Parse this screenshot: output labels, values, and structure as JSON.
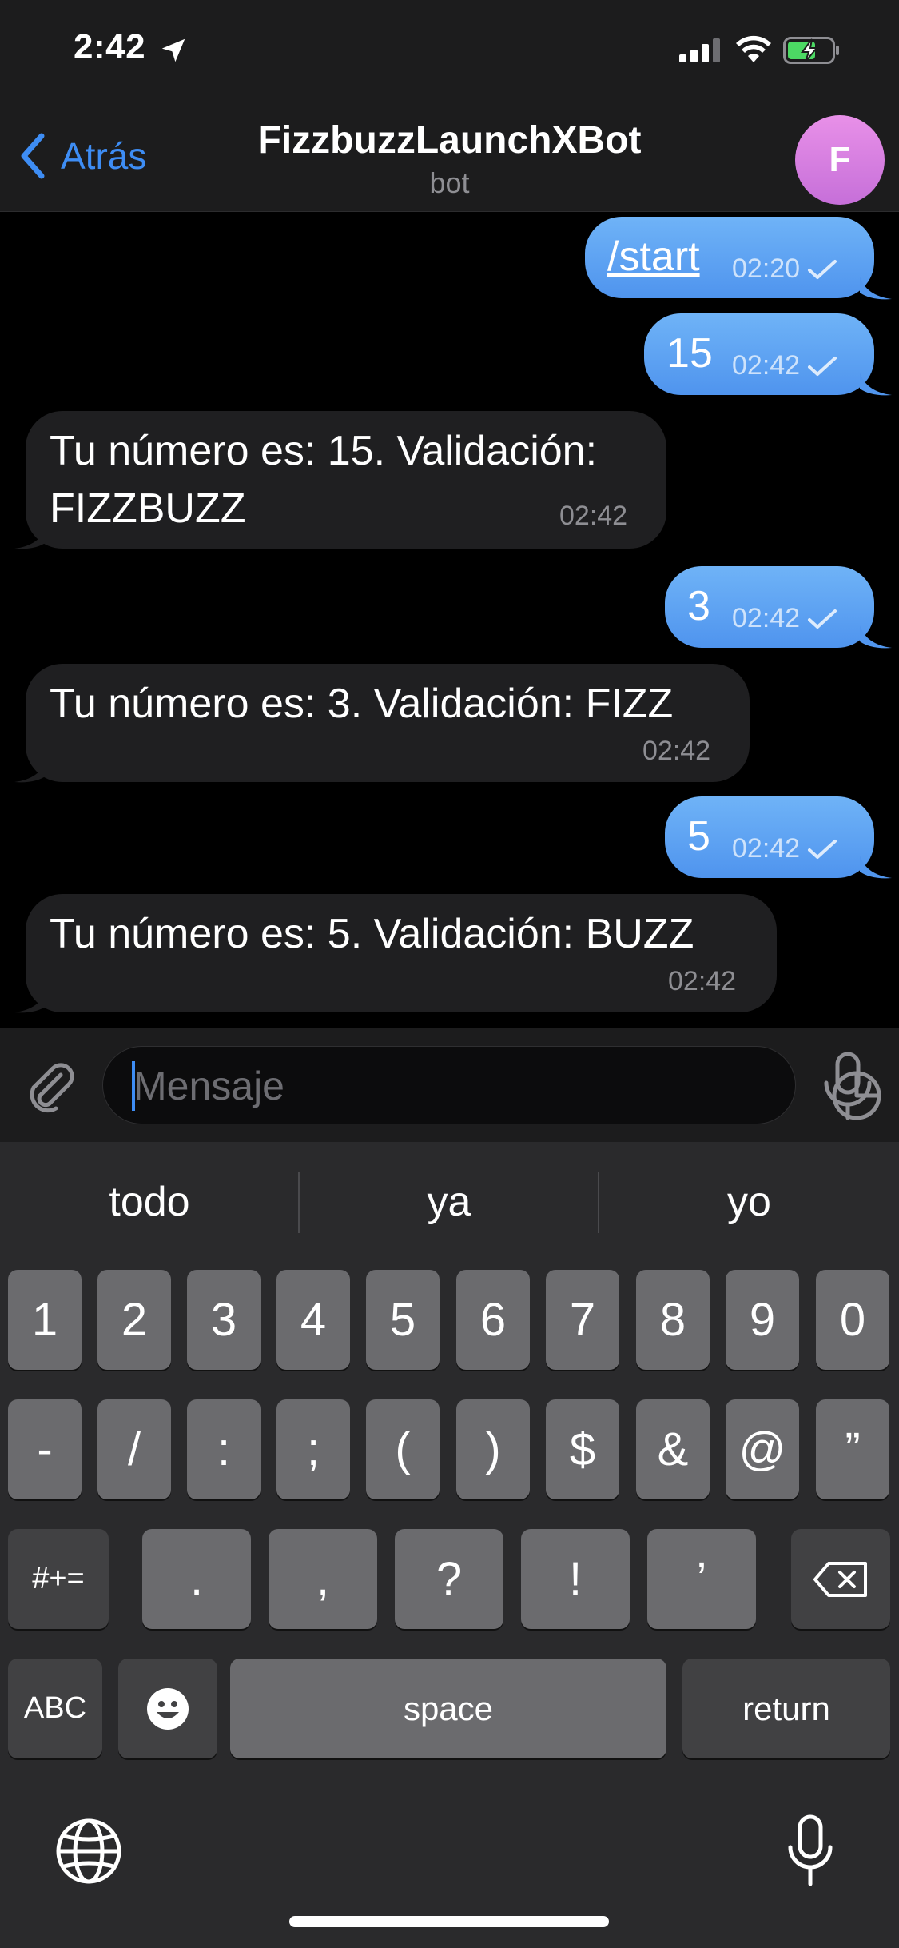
{
  "status_bar": {
    "time": "2:42"
  },
  "nav": {
    "back_label": "Atrás",
    "title": "FizzbuzzLaunchXBot",
    "subtitle": "bot",
    "avatar_letter": "F"
  },
  "messages": [
    {
      "direction": "out",
      "text": "/start",
      "time": "02:20",
      "is_command": true
    },
    {
      "direction": "out",
      "text": "15",
      "time": "02:42"
    },
    {
      "direction": "in",
      "text_line1": "Tu número es: 15. Validación:",
      "text_line2": "FIZZBUZZ",
      "time": "02:42"
    },
    {
      "direction": "out",
      "text": "3",
      "time": "02:42"
    },
    {
      "direction": "in",
      "text": "Tu número es: 3. Validación: FIZZ",
      "time": "02:42"
    },
    {
      "direction": "out",
      "text": "5",
      "time": "02:42"
    },
    {
      "direction": "in",
      "text": "Tu número es: 5. Validación: BUZZ",
      "time": "02:42"
    }
  ],
  "input": {
    "placeholder": "Mensaje"
  },
  "keyboard": {
    "suggestions": [
      "todo",
      "ya",
      "yo"
    ],
    "row1": [
      "1",
      "2",
      "3",
      "4",
      "5",
      "6",
      "7",
      "8",
      "9",
      "0"
    ],
    "row2": [
      "-",
      "/",
      ":",
      ";",
      "(",
      ")",
      "$",
      "&",
      "@",
      "”"
    ],
    "row3": {
      "mode": "#+=",
      "keys": [
        ".",
        ",",
        "?",
        "!",
        "’"
      ]
    },
    "row4": {
      "abc": "ABC",
      "space": "space",
      "return": "return"
    }
  },
  "colors": {
    "accent": "#3e8df4",
    "outgoing_bubble": "#5a9ff2",
    "incoming_bubble": "#1f1f21",
    "avatar": "#d27fe0"
  }
}
